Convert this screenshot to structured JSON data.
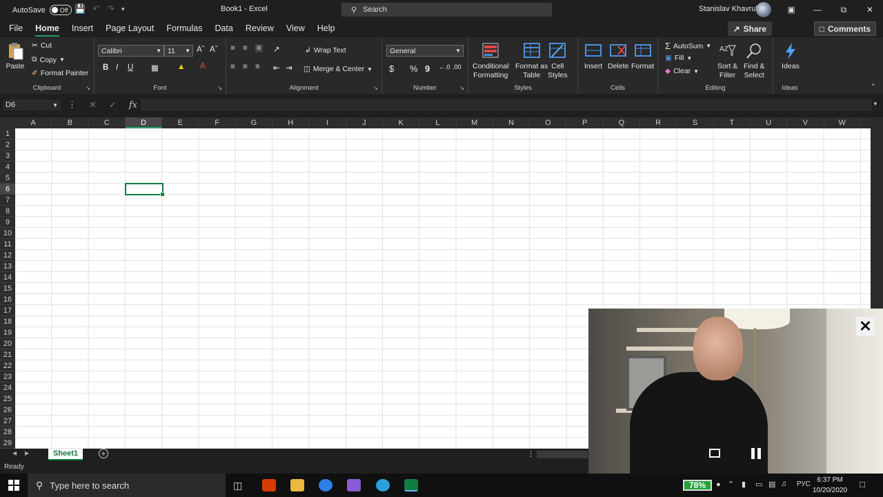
{
  "window": {
    "autosave_label": "AutoSave",
    "autosave_state": "Off",
    "doc_title": "Book1  -  Excel",
    "search_placeholder": "Search",
    "user_name": "Stanislav Khavruk"
  },
  "tabs": [
    "File",
    "Home",
    "Insert",
    "Page Layout",
    "Formulas",
    "Data",
    "Review",
    "View",
    "Help"
  ],
  "active_tab": "Home",
  "share_label": "Share",
  "comments_label": "Comments",
  "ribbon": {
    "clipboard": {
      "label": "Clipboard",
      "paste": "Paste",
      "cut": "Cut",
      "copy": "Copy",
      "format_painter": "Format Painter"
    },
    "font": {
      "label": "Font",
      "font_name": "Calibri",
      "font_size": "11",
      "bold": "B",
      "italic": "I",
      "underline": "U"
    },
    "alignment": {
      "label": "Alignment",
      "wrap_text": "Wrap Text",
      "merge_center": "Merge & Center"
    },
    "number": {
      "label": "Number",
      "format": "General",
      "currency": "$",
      "percent": "%",
      "comma": "9"
    },
    "styles": {
      "label": "Styles",
      "conditional_1": "Conditional",
      "conditional_2": "Formatting",
      "format_table_1": "Format as",
      "format_table_2": "Table",
      "cell_styles_1": "Cell",
      "cell_styles_2": "Styles"
    },
    "cells": {
      "label": "Cells",
      "insert": "Insert",
      "delete": "Delete",
      "format": "Format"
    },
    "editing": {
      "label": "Editing",
      "autosum": "AutoSum",
      "fill": "Fill",
      "clear": "Clear",
      "sort_1": "Sort &",
      "sort_2": "Filter",
      "find_1": "Find &",
      "find_2": "Select"
    },
    "ideas": {
      "label": "Ideas",
      "button": "Ideas"
    }
  },
  "formula_bar": {
    "name_box": "D6",
    "fx": "fx",
    "value": ""
  },
  "columns": [
    "A",
    "B",
    "C",
    "D",
    "E",
    "F",
    "G",
    "H",
    "I",
    "J",
    "K",
    "L",
    "M",
    "N",
    "O",
    "P",
    "Q",
    "R",
    "S",
    "T",
    "U",
    "V",
    "W"
  ],
  "selected_column": "D",
  "rows": [
    "1",
    "2",
    "3",
    "4",
    "5",
    "6",
    "7",
    "8",
    "9",
    "10",
    "11",
    "12",
    "13",
    "14",
    "15",
    "16",
    "17",
    "18",
    "19",
    "20",
    "21",
    "22",
    "23",
    "24",
    "25",
    "26",
    "27",
    "28",
    "29"
  ],
  "selected_row": "6",
  "sheet_tab": "Sheet1",
  "status": "Ready",
  "taskbar": {
    "search_placeholder": "Type here to search",
    "battery": "78%",
    "language": "РУС",
    "time": "6:37 PM",
    "date": "10/20/2020"
  },
  "colors": {
    "accent": "#107c41",
    "background": "#1f1f1f",
    "ribbon": "#292929"
  }
}
